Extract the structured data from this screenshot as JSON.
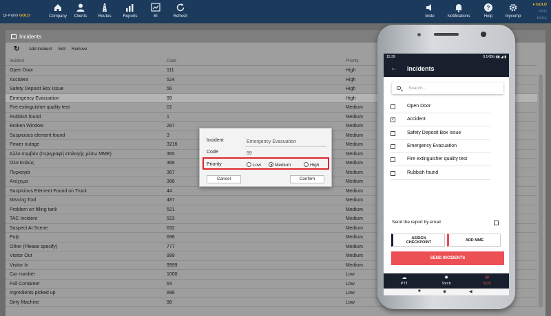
{
  "brand": {
    "name": "Qr-Patrol",
    "tier": "GOLD"
  },
  "nav": [
    {
      "label": "Company",
      "icon": "home-icon"
    },
    {
      "label": "Clients",
      "icon": "user-icon"
    },
    {
      "label": "Routes",
      "icon": "road-icon"
    },
    {
      "label": "Reports",
      "icon": "bar-chart-icon"
    },
    {
      "label": "BI",
      "icon": "bi-chart-icon"
    },
    {
      "label": "Refresh",
      "icon": "refresh-icon"
    }
  ],
  "nav_right": [
    {
      "label": "Mute",
      "icon": "speaker-icon"
    },
    {
      "label": "Notifications",
      "icon": "bell-icon"
    },
    {
      "label": "Help",
      "icon": "help-icon"
    },
    {
      "label": "mycomp",
      "icon": "gear-icon"
    }
  ],
  "tiers": {
    "gold": "GOLD",
    "pro": "PRO",
    "base": "BASE"
  },
  "panel": {
    "title": "Incidents"
  },
  "toolbar": {
    "add": "Add Incident",
    "edit": "Edit",
    "remove": "Remove"
  },
  "grid": {
    "headers": {
      "incident": "Incident",
      "code": "Code",
      "priority": "Priority"
    },
    "rows": [
      {
        "incident": "Open Door",
        "code": "111",
        "priority": "High"
      },
      {
        "incident": "Accident",
        "code": "524",
        "priority": "High"
      },
      {
        "incident": "Safety Deposit Box Issue",
        "code": "56",
        "priority": "High"
      },
      {
        "incident": "Emergency Evacuation",
        "code": "99",
        "priority": "High"
      },
      {
        "incident": "Fire extinguisher quality test",
        "code": "01",
        "priority": "Medium"
      },
      {
        "incident": "Rubbish found",
        "code": "1",
        "priority": "Medium"
      },
      {
        "incident": "Broken Window",
        "code": "287",
        "priority": "Medium"
      },
      {
        "incident": "Suspicious element found",
        "code": "3",
        "priority": "Medium"
      },
      {
        "incident": "Power outage",
        "code": "3216",
        "priority": "Medium"
      },
      {
        "incident": "Άλλο συμβάν (περιγραφή επιλογής μέσω ΜΜΕ)",
        "code": "365",
        "priority": "Medium"
      },
      {
        "incident": "Όλα Καλώς",
        "code": "366",
        "priority": "Medium"
      },
      {
        "incident": "Πυρκαγιά",
        "code": "367",
        "priority": "Medium"
      },
      {
        "incident": "Ατύχημα",
        "code": "368",
        "priority": "Medium"
      },
      {
        "incident": "Suspicious Element Found on Truck",
        "code": "44",
        "priority": "Medium"
      },
      {
        "incident": "Missing Tool",
        "code": "487",
        "priority": "Medium"
      },
      {
        "incident": "Problem on filling tank",
        "code": "521",
        "priority": "Medium"
      },
      {
        "incident": "TAC Incident",
        "code": "523",
        "priority": "Medium"
      },
      {
        "incident": "Suspect At Scene",
        "code": "632",
        "priority": "Medium"
      },
      {
        "incident": "Pulp",
        "code": "696",
        "priority": "Medium"
      },
      {
        "incident": "Other (Please specify)",
        "code": "777",
        "priority": "Medium"
      },
      {
        "incident": "Visitor Out",
        "code": "999",
        "priority": "Medium"
      },
      {
        "incident": "Visitor In",
        "code": "9999",
        "priority": "Medium"
      },
      {
        "incident": "Car number",
        "code": "1000",
        "priority": "Low"
      },
      {
        "incident": "Full Container",
        "code": "64",
        "priority": "Low"
      },
      {
        "incident": "Ingredients picked up",
        "code": "896",
        "priority": "Low"
      },
      {
        "incident": "Dirty Machine",
        "code": "98",
        "priority": "Low"
      }
    ]
  },
  "dialog": {
    "incident_label": "Incident",
    "incident_value": "Emergency Evacuation",
    "code_label": "Code",
    "code_value": "99",
    "priority_label": "Priority",
    "options": [
      "Low",
      "Medium",
      "High"
    ],
    "selected": "Medium",
    "cancel": "Cancel",
    "confirm": "Confirm"
  },
  "phone": {
    "time": "15:39",
    "net": "0.1KB/s",
    "title": "Incidents",
    "search_placeholder": "Search...",
    "items": [
      {
        "label": "Open Door",
        "checked": false
      },
      {
        "label": "Accident",
        "checked": true
      },
      {
        "label": "Safety Deposit Box Issue",
        "checked": false
      },
      {
        "label": "Emergency Evacuation",
        "checked": false
      },
      {
        "label": "Fire extinguisher quality test",
        "checked": false
      },
      {
        "label": "Rubbish found",
        "checked": false
      }
    ],
    "email_label": "Send the report by email",
    "assign_line1": "ASSIGN",
    "assign_line2": "CHECKPOINT",
    "add_mme": "ADD MME",
    "send": "SEND INCIDENTS",
    "bottom": [
      {
        "label": "PTT",
        "icon": "cloud-icon"
      },
      {
        "label": "Torch",
        "icon": "torch-icon"
      },
      {
        "label": "SOS",
        "icon": "mail-icon"
      }
    ]
  }
}
